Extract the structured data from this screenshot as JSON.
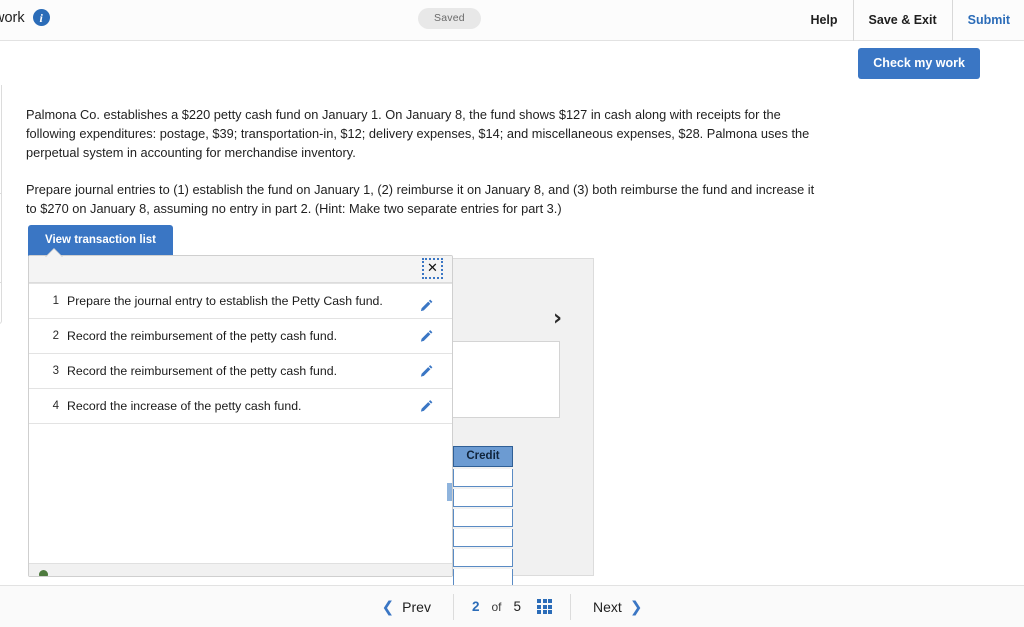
{
  "header": {
    "title": "work",
    "info_icon": "info-icon",
    "status_pill": "Saved",
    "links": [
      {
        "label": "Help",
        "name": "help-link"
      },
      {
        "label": "Save & Exit",
        "name": "save-and-exit-link"
      },
      {
        "label": "Submit",
        "name": "submit-link"
      }
    ],
    "check_my_work": "Check my work"
  },
  "problem": {
    "paragraph1": "Palmona Co. establishes a $220 petty cash fund on January 1. On January 8, the fund shows $127 in cash along with receipts for the following expenditures: postage, $39; transportation-in, $12; delivery expenses, $14; and miscellaneous expenses, $28. Palmona uses the perpetual system in accounting for merchandise inventory.",
    "paragraph2": "Prepare journal entries to (1) establish the fund on January 1, (2) reimburse it on January 8, and (3) both reimburse the fund and increase it to $270 on January 8, assuming no entry in part 2. (Hint: Make two separate entries for part 3.)"
  },
  "transaction_panel": {
    "tab_label": "View transaction list",
    "close_label": "✕",
    "rows": [
      {
        "num": "1",
        "text": "Prepare the journal entry to establish the Petty Cash fund."
      },
      {
        "num": "2",
        "text": "Record the reimbursement of the petty cash fund."
      },
      {
        "num": "3",
        "text": "Record the reimbursement of the petty cash fund."
      },
      {
        "num": "4",
        "text": "Record the increase of the petty cash fund."
      }
    ]
  },
  "journal": {
    "credit_header": "Credit",
    "credit_rows": [
      "",
      "",
      "",
      "",
      "",
      ""
    ],
    "chevron": "›"
  },
  "pagination": {
    "prev": "Prev",
    "next": "Next",
    "current": "2",
    "of": "of",
    "total": "5"
  },
  "colors": {
    "accent_blue": "#3a76c4",
    "link_blue": "#2b6cb8",
    "credit_header_blue": "#6c9bd2"
  }
}
